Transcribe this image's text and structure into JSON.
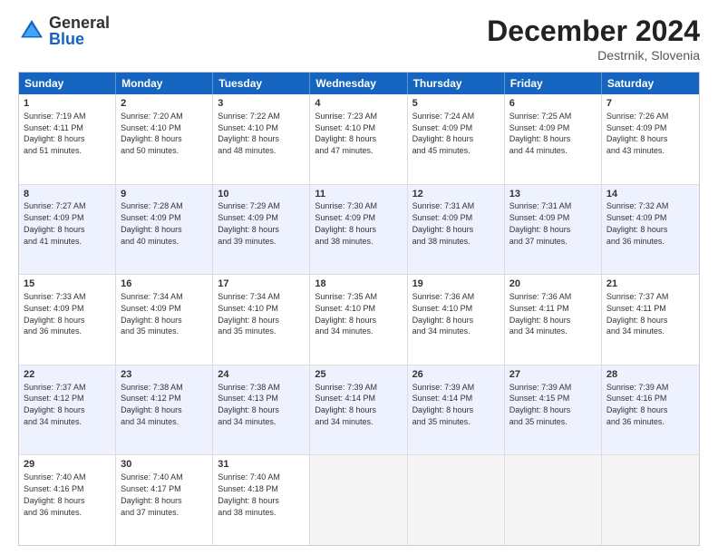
{
  "logo": {
    "general": "General",
    "blue": "Blue"
  },
  "title": "December 2024",
  "location": "Destrnik, Slovenia",
  "days": [
    "Sunday",
    "Monday",
    "Tuesday",
    "Wednesday",
    "Thursday",
    "Friday",
    "Saturday"
  ],
  "weeks": [
    {
      "alt": false,
      "cells": [
        {
          "empty": true
        },
        {
          "day": "2",
          "lines": [
            "Sunrise: 7:20 AM",
            "Sunset: 4:10 PM",
            "Daylight: 8 hours",
            "and 50 minutes."
          ]
        },
        {
          "day": "3",
          "lines": [
            "Sunrise: 7:22 AM",
            "Sunset: 4:10 PM",
            "Daylight: 8 hours",
            "and 48 minutes."
          ]
        },
        {
          "day": "4",
          "lines": [
            "Sunrise: 7:23 AM",
            "Sunset: 4:10 PM",
            "Daylight: 8 hours",
            "and 47 minutes."
          ]
        },
        {
          "day": "5",
          "lines": [
            "Sunrise: 7:24 AM",
            "Sunset: 4:09 PM",
            "Daylight: 8 hours",
            "and 45 minutes."
          ]
        },
        {
          "day": "6",
          "lines": [
            "Sunrise: 7:25 AM",
            "Sunset: 4:09 PM",
            "Daylight: 8 hours",
            "and 44 minutes."
          ]
        },
        {
          "day": "7",
          "lines": [
            "Sunrise: 7:26 AM",
            "Sunset: 4:09 PM",
            "Daylight: 8 hours",
            "and 43 minutes."
          ]
        }
      ]
    },
    {
      "alt": true,
      "cells": [
        {
          "day": "8",
          "lines": [
            "Sunrise: 7:27 AM",
            "Sunset: 4:09 PM",
            "Daylight: 8 hours",
            "and 41 minutes."
          ]
        },
        {
          "day": "9",
          "lines": [
            "Sunrise: 7:28 AM",
            "Sunset: 4:09 PM",
            "Daylight: 8 hours",
            "and 40 minutes."
          ]
        },
        {
          "day": "10",
          "lines": [
            "Sunrise: 7:29 AM",
            "Sunset: 4:09 PM",
            "Daylight: 8 hours",
            "and 39 minutes."
          ]
        },
        {
          "day": "11",
          "lines": [
            "Sunrise: 7:30 AM",
            "Sunset: 4:09 PM",
            "Daylight: 8 hours",
            "and 38 minutes."
          ]
        },
        {
          "day": "12",
          "lines": [
            "Sunrise: 7:31 AM",
            "Sunset: 4:09 PM",
            "Daylight: 8 hours",
            "and 38 minutes."
          ]
        },
        {
          "day": "13",
          "lines": [
            "Sunrise: 7:31 AM",
            "Sunset: 4:09 PM",
            "Daylight: 8 hours",
            "and 37 minutes."
          ]
        },
        {
          "day": "14",
          "lines": [
            "Sunrise: 7:32 AM",
            "Sunset: 4:09 PM",
            "Daylight: 8 hours",
            "and 36 minutes."
          ]
        }
      ]
    },
    {
      "alt": false,
      "cells": [
        {
          "day": "15",
          "lines": [
            "Sunrise: 7:33 AM",
            "Sunset: 4:09 PM",
            "Daylight: 8 hours",
            "and 36 minutes."
          ]
        },
        {
          "day": "16",
          "lines": [
            "Sunrise: 7:34 AM",
            "Sunset: 4:09 PM",
            "Daylight: 8 hours",
            "and 35 minutes."
          ]
        },
        {
          "day": "17",
          "lines": [
            "Sunrise: 7:34 AM",
            "Sunset: 4:10 PM",
            "Daylight: 8 hours",
            "and 35 minutes."
          ]
        },
        {
          "day": "18",
          "lines": [
            "Sunrise: 7:35 AM",
            "Sunset: 4:10 PM",
            "Daylight: 8 hours",
            "and 34 minutes."
          ]
        },
        {
          "day": "19",
          "lines": [
            "Sunrise: 7:36 AM",
            "Sunset: 4:10 PM",
            "Daylight: 8 hours",
            "and 34 minutes."
          ]
        },
        {
          "day": "20",
          "lines": [
            "Sunrise: 7:36 AM",
            "Sunset: 4:11 PM",
            "Daylight: 8 hours",
            "and 34 minutes."
          ]
        },
        {
          "day": "21",
          "lines": [
            "Sunrise: 7:37 AM",
            "Sunset: 4:11 PM",
            "Daylight: 8 hours",
            "and 34 minutes."
          ]
        }
      ]
    },
    {
      "alt": true,
      "cells": [
        {
          "day": "22",
          "lines": [
            "Sunrise: 7:37 AM",
            "Sunset: 4:12 PM",
            "Daylight: 8 hours",
            "and 34 minutes."
          ]
        },
        {
          "day": "23",
          "lines": [
            "Sunrise: 7:38 AM",
            "Sunset: 4:12 PM",
            "Daylight: 8 hours",
            "and 34 minutes."
          ]
        },
        {
          "day": "24",
          "lines": [
            "Sunrise: 7:38 AM",
            "Sunset: 4:13 PM",
            "Daylight: 8 hours",
            "and 34 minutes."
          ]
        },
        {
          "day": "25",
          "lines": [
            "Sunrise: 7:39 AM",
            "Sunset: 4:14 PM",
            "Daylight: 8 hours",
            "and 34 minutes."
          ]
        },
        {
          "day": "26",
          "lines": [
            "Sunrise: 7:39 AM",
            "Sunset: 4:14 PM",
            "Daylight: 8 hours",
            "and 35 minutes."
          ]
        },
        {
          "day": "27",
          "lines": [
            "Sunrise: 7:39 AM",
            "Sunset: 4:15 PM",
            "Daylight: 8 hours",
            "and 35 minutes."
          ]
        },
        {
          "day": "28",
          "lines": [
            "Sunrise: 7:39 AM",
            "Sunset: 4:16 PM",
            "Daylight: 8 hours",
            "and 36 minutes."
          ]
        }
      ]
    },
    {
      "alt": false,
      "cells": [
        {
          "day": "29",
          "lines": [
            "Sunrise: 7:40 AM",
            "Sunset: 4:16 PM",
            "Daylight: 8 hours",
            "and 36 minutes."
          ]
        },
        {
          "day": "30",
          "lines": [
            "Sunrise: 7:40 AM",
            "Sunset: 4:17 PM",
            "Daylight: 8 hours",
            "and 37 minutes."
          ]
        },
        {
          "day": "31",
          "lines": [
            "Sunrise: 7:40 AM",
            "Sunset: 4:18 PM",
            "Daylight: 8 hours",
            "and 38 minutes."
          ]
        },
        {
          "empty": true
        },
        {
          "empty": true
        },
        {
          "empty": true
        },
        {
          "empty": true
        }
      ]
    }
  ],
  "week0": {
    "day1": {
      "num": "1",
      "lines": [
        "Sunrise: 7:19 AM",
        "Sunset: 4:11 PM",
        "Daylight: 8 hours",
        "and 51 minutes."
      ]
    }
  }
}
